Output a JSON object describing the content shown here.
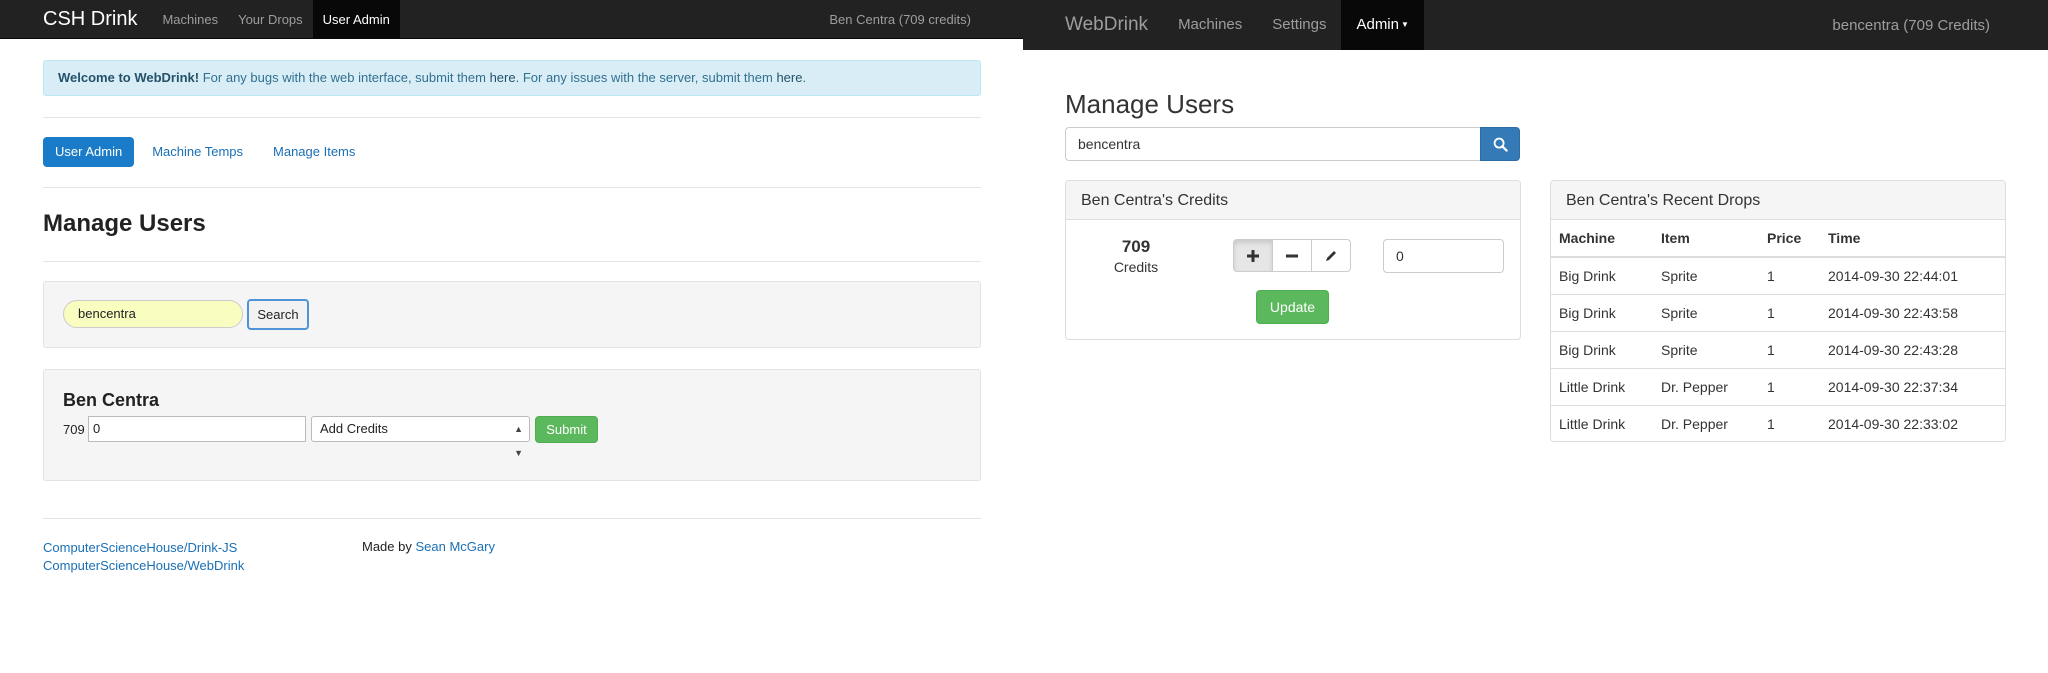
{
  "left": {
    "navbar": {
      "brand": "CSH Drink",
      "links": [
        "Machines",
        "Your Drops",
        "User Admin"
      ],
      "user_info": "Ben Centra (709 credits)"
    },
    "alert": {
      "strong": "Welcome to WebDrink!",
      "text1": " For any bugs with the web interface, submit them ",
      "link1": "here",
      "text2": ". For any issues with the server, submit them ",
      "link2": "here",
      "text3": "."
    },
    "pills": [
      "User Admin",
      "Machine Temps",
      "Manage Items"
    ],
    "heading": "Manage Users",
    "search": {
      "value": "bencentra",
      "button": "Search"
    },
    "user": {
      "name": "Ben Centra",
      "credits": "709",
      "amount": "0",
      "action": "Add Credits",
      "submit": "Submit"
    },
    "footer": {
      "links": [
        "ComputerScienceHouse/Drink-JS",
        "ComputerScienceHouse/WebDrink"
      ],
      "made_by": "Made by ",
      "author": "Sean McGary"
    }
  },
  "right": {
    "navbar": {
      "brand": "WebDrink",
      "links": [
        "Machines",
        "Settings",
        "Admin"
      ],
      "user_info": "bencentra (709 Credits)"
    },
    "heading": "Manage Users",
    "search": {
      "value": "bencentra",
      "icon": "search-icon"
    },
    "credits_panel": {
      "title": "Ben Centra's Credits",
      "value": "709",
      "label": "Credits",
      "amount": "0",
      "update": "Update",
      "icons": [
        "plus-icon",
        "minus-icon",
        "pencil-icon"
      ]
    },
    "drops_panel": {
      "title": "Ben Centra's Recent Drops",
      "columns": [
        "Machine",
        "Item",
        "Price",
        "Time"
      ],
      "rows": [
        [
          "Big Drink",
          "Sprite",
          "1",
          "2014-09-30 22:44:01"
        ],
        [
          "Big Drink",
          "Sprite",
          "1",
          "2014-09-30 22:43:58"
        ],
        [
          "Big Drink",
          "Sprite",
          "1",
          "2014-09-30 22:43:28"
        ],
        [
          "Little Drink",
          "Dr. Pepper",
          "1",
          "2014-09-30 22:37:34"
        ],
        [
          "Little Drink",
          "Dr. Pepper",
          "1",
          "2014-09-30 22:33:02"
        ]
      ]
    }
  }
}
